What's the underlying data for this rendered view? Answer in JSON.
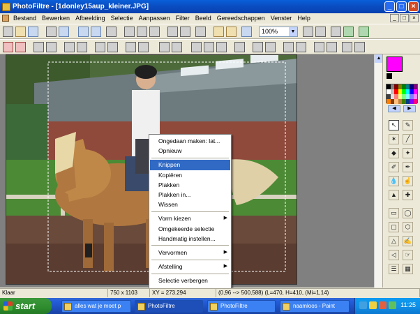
{
  "window": {
    "title": "PhotoFiltre - [1donley15aup_kleiner.JPG]",
    "min": "_",
    "max": "□",
    "close": "×"
  },
  "menu": [
    "Bestand",
    "Bewerken",
    "Afbeelding",
    "Selectie",
    "Aanpassen",
    "Filter",
    "Beeld",
    "Gereedschappen",
    "Venster",
    "Help"
  ],
  "toolbar": {
    "zoom_value": "100%",
    "zoom_arrow": "▼"
  },
  "context_menu": {
    "items": [
      {
        "label": "Ongedaan maken: lat...",
        "type": "item",
        "has_sub": false
      },
      {
        "label": "Opnieuw",
        "type": "item",
        "has_sub": false
      },
      {
        "type": "sep"
      },
      {
        "label": "Knippen",
        "type": "item",
        "has_sub": false,
        "highlighted": true
      },
      {
        "label": "Kopiëren",
        "type": "item",
        "has_sub": false
      },
      {
        "label": "Plakken",
        "type": "item",
        "has_sub": false
      },
      {
        "label": "Plakken in...",
        "type": "item",
        "has_sub": false
      },
      {
        "label": "Wissen",
        "type": "item",
        "has_sub": false
      },
      {
        "type": "sep"
      },
      {
        "label": "Vorm kiezen",
        "type": "item",
        "has_sub": true
      },
      {
        "label": "Omgekeerde selectie",
        "type": "item",
        "has_sub": false
      },
      {
        "label": "Handmatig instellen...",
        "type": "item",
        "has_sub": false
      },
      {
        "type": "sep"
      },
      {
        "label": "Vervormen",
        "type": "item",
        "has_sub": true
      },
      {
        "type": "sep"
      },
      {
        "label": "Afstelling",
        "type": "item",
        "has_sub": true
      },
      {
        "type": "sep"
      },
      {
        "label": "Selectie verbergen",
        "type": "item",
        "has_sub": false
      }
    ],
    "submenu_arrow": "▶"
  },
  "palette": {
    "foreground": "#ff00ff",
    "background": "#000000",
    "swatches": [
      "#000000",
      "#808080",
      "#800000",
      "#808000",
      "#008000",
      "#008080",
      "#000080",
      "#800080",
      "#ffffff",
      "#c0c0c0",
      "#ff0000",
      "#ffff00",
      "#00ff00",
      "#00ffff",
      "#0000ff",
      "#ff00ff",
      "#404040",
      "#e0e0e0",
      "#ff8080",
      "#ffff80",
      "#80ff80",
      "#80ffff",
      "#8080ff",
      "#ff80ff",
      "#ff8000",
      "#804000",
      "#ffc080",
      "#c08040",
      "#408000",
      "#004080",
      "#8000ff",
      "#ff0080"
    ],
    "arrow_left": "◀",
    "arrow_right": "▶"
  },
  "statusbar": {
    "status": "Klaar",
    "size": "750 x 1103",
    "selection": "XY = 273.294",
    "coords": "(0,96 --> 500,588) (L=470, H=410, (Mi=1,14)"
  },
  "taskbar": {
    "start": "start",
    "tasks": [
      {
        "label": "alles wat je moet p",
        "active": false
      },
      {
        "label": "PhotoFiltre",
        "active": true
      },
      {
        "label": "PhotoFiltre",
        "active": false
      },
      {
        "label": "naamloos - Paint",
        "active": false
      }
    ],
    "clock": "11:25"
  },
  "accent": "#316ac5"
}
